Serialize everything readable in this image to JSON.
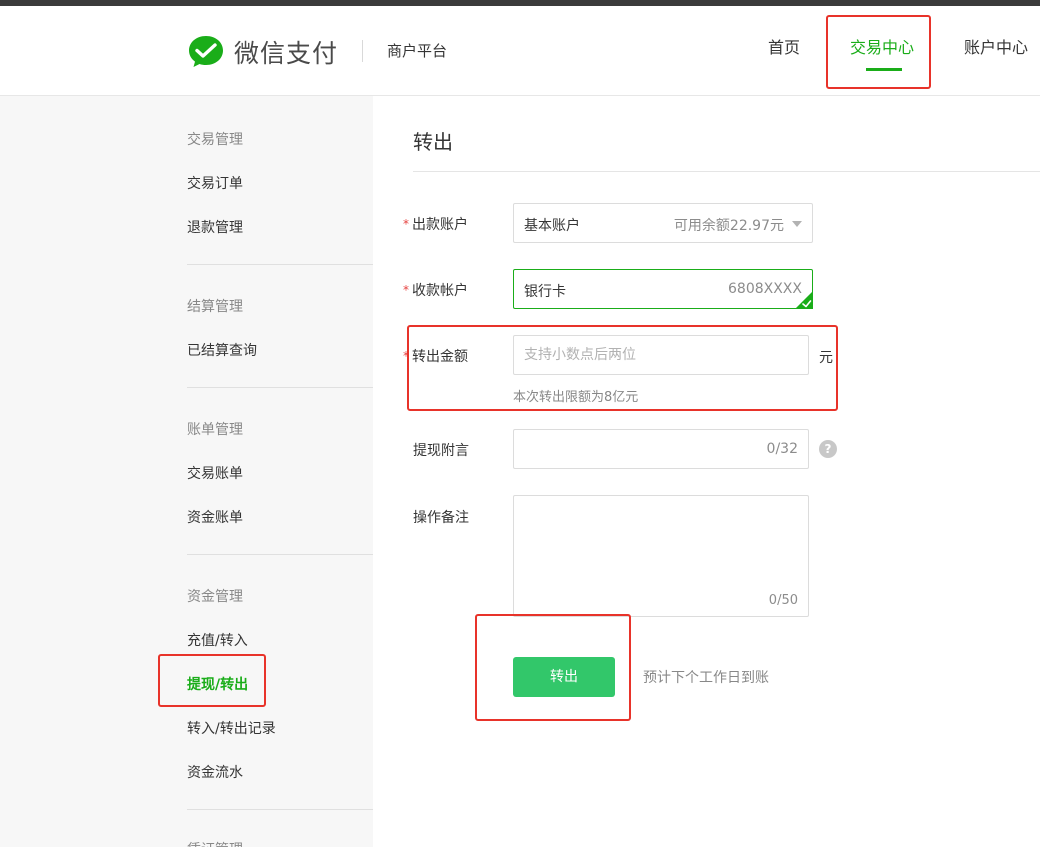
{
  "header": {
    "brand": "微信支付",
    "platform": "商户平台",
    "nav": [
      {
        "label": "首页"
      },
      {
        "label": "交易中心",
        "active": true
      },
      {
        "label": "账户中心"
      }
    ]
  },
  "sidebar": {
    "groups": [
      {
        "title": "交易管理",
        "items": [
          "交易订单",
          "退款管理"
        ]
      },
      {
        "title": "结算管理",
        "items": [
          "已结算查询"
        ]
      },
      {
        "title": "账单管理",
        "items": [
          "交易账单",
          "资金账单"
        ]
      },
      {
        "title": "资金管理",
        "items": [
          "充值/转入",
          "提现/转出",
          "转入/转出记录",
          "资金流水"
        ]
      },
      {
        "title": "凭证管理",
        "items": []
      }
    ],
    "active_item": "提现/转出"
  },
  "form": {
    "title": "转出",
    "required_mark": "*",
    "out_account": {
      "label": "出款账户",
      "value": "基本账户",
      "balance": "可用余额22.97元"
    },
    "receive_account": {
      "label": "收款帐户",
      "value": "银行卡",
      "card": "6808XXXX"
    },
    "amount": {
      "label": "转出金额",
      "placeholder": "支持小数点后两位",
      "unit": "元",
      "hint": "本次转出限额为8亿元"
    },
    "memo": {
      "label": "提现附言",
      "counter": "0/32",
      "help": "?"
    },
    "remark": {
      "label": "操作备注",
      "counter": "0/50"
    },
    "submit": {
      "label": "转出",
      "note": "预计下个工作日到账"
    }
  },
  "colors": {
    "brand_green": "#1aad19",
    "button_green": "#32c76a",
    "highlight_red": "#e8332a",
    "required_red": "#e64340"
  }
}
